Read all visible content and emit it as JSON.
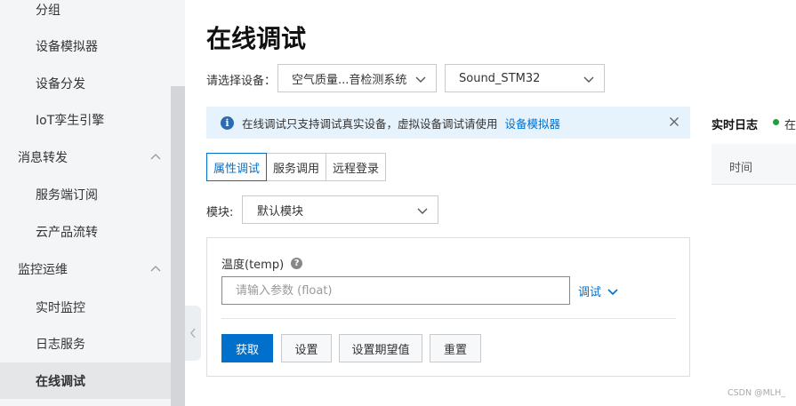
{
  "sidebar": {
    "items": [
      {
        "label": "分组",
        "type": "child"
      },
      {
        "label": "设备模拟器",
        "type": "child"
      },
      {
        "label": "设备分发",
        "type": "child"
      },
      {
        "label": "IoT孪生引擎",
        "type": "child"
      },
      {
        "label": "消息转发",
        "type": "group"
      },
      {
        "label": "服务端订阅",
        "type": "child"
      },
      {
        "label": "云产品流转",
        "type": "child"
      },
      {
        "label": "监控运维",
        "type": "group"
      },
      {
        "label": "实时监控",
        "type": "child"
      },
      {
        "label": "日志服务",
        "type": "child"
      },
      {
        "label": "在线调试",
        "type": "child",
        "active": true
      }
    ]
  },
  "page": {
    "title": "在线调试",
    "device_label": "请选择设备：",
    "product_select": "空气质量...音检测系统",
    "device_select": "Sound_STM32"
  },
  "notice": {
    "text": "在线调试只支持调试真实设备，虚拟设备调试请使用",
    "link": "设备模拟器"
  },
  "tabs": [
    "属性调试",
    "服务调用",
    "远程登录"
  ],
  "module": {
    "label": "模块:",
    "value": "默认模块"
  },
  "property": {
    "label": "温度(temp)",
    "help": "?",
    "placeholder": "请输入参数 (float)",
    "debug_label": "调试"
  },
  "buttons": {
    "get": "获取",
    "set": "设置",
    "set_expected": "设置期望值",
    "reset": "重置"
  },
  "log": {
    "title": "实时日志",
    "status": "在",
    "column_time": "时间"
  },
  "watermark": "CSDN @MLH_",
  "colors": {
    "primary": "#0070cc",
    "online": "#1e9e3e",
    "notice_bg": "#e6f3fc"
  }
}
